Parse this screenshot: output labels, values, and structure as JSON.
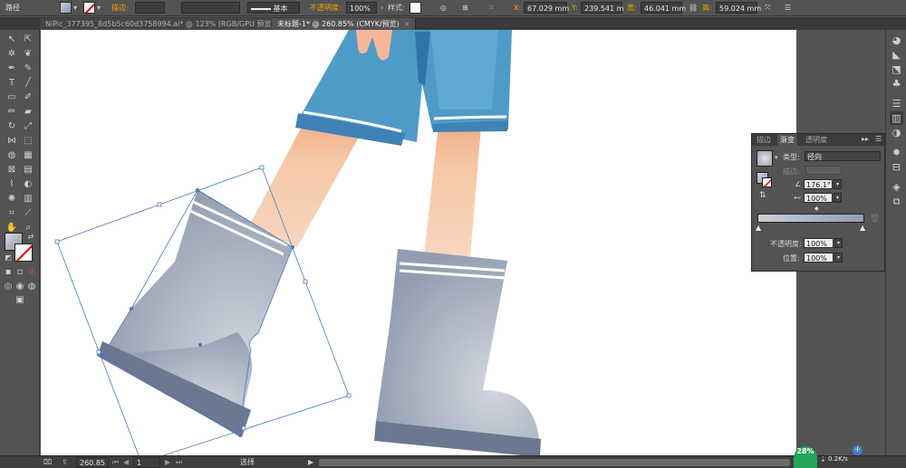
{
  "control_bar": {
    "selection_label": "路径",
    "stroke_label": "描边:",
    "stroke_style": "基本",
    "opacity_label": "不透明度:",
    "opacity_value": "100%",
    "style_label": "样式:",
    "x_label": "X:",
    "x_value": "67.029 mm",
    "y_label": "Y:",
    "y_value": "239.541 m",
    "w_label": "宽:",
    "w_value": "46.041 mm",
    "h_label": "高:",
    "h_value": "59.024 mm",
    "icons": [
      "fill-swatch-icon",
      "stroke-none-icon",
      "recolor-icon",
      "align-icon",
      "transform-icon",
      "constrain-icon",
      "more-icon"
    ]
  },
  "tabs": [
    {
      "label": "NiPic_377395_8d5b5c60d3758994.ai* @ 123% (RGB/GPU 预览)",
      "close": "×"
    },
    {
      "label": "未标题-1* @ 260.85% (CMYK/预览)",
      "close": "×"
    }
  ],
  "status_bar": {
    "zoom": "260.85",
    "page": "1",
    "mode": "选择"
  },
  "gradient_panel": {
    "tabs": [
      "描边",
      "渐变",
      "透明度"
    ],
    "type_label": "类型:",
    "type_value": "径向",
    "stroke_label": "描边:",
    "angle_value": "176.1°",
    "aspect_value": "100%",
    "opacity_label": "不透明度:",
    "opacity_value": "100%",
    "position_label": "位置:",
    "position_value": "100%",
    "gradient_start": "#c9cfda",
    "gradient_end": "#949eb1"
  },
  "network": {
    "percent": "28%",
    "speed": "0.2K/s",
    "plus": "+"
  },
  "colors": {
    "ui_dark": "#535353",
    "boot_main": "#9aa3b5",
    "boot_sole": "#6c7790",
    "shorts_blue": "#4f9bc7",
    "skin": "#f3c6a4",
    "selection": "#4a7ab8"
  }
}
